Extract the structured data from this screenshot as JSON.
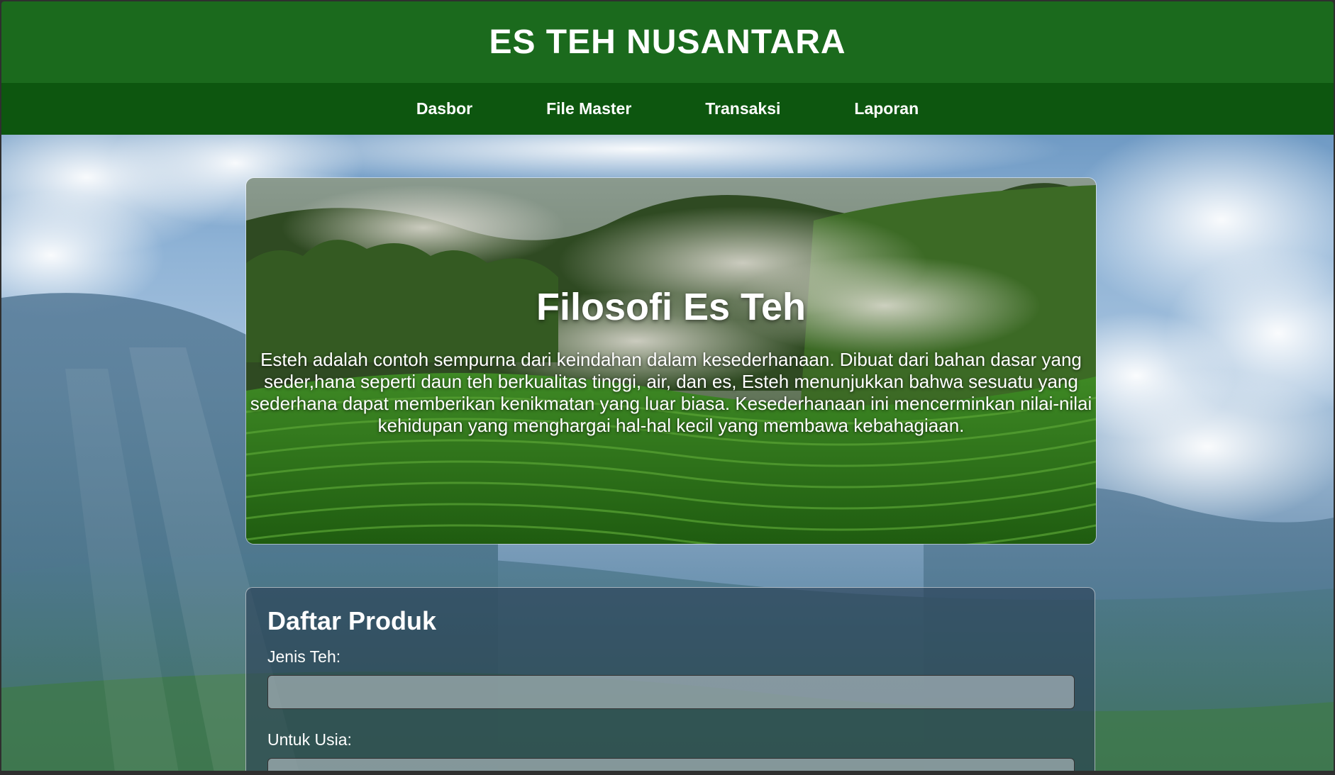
{
  "app": {
    "title": "ES TEH NUSANTARA"
  },
  "nav": {
    "items": [
      {
        "label": "Dasbor"
      },
      {
        "label": "File Master"
      },
      {
        "label": "Transaksi"
      },
      {
        "label": "Laporan"
      }
    ]
  },
  "hero": {
    "title": "Filosofi Es Teh",
    "text": "Esteh adalah contoh sempurna dari keindahan dalam kesederhanaan. Dibuat dari bahan dasar yang seder,hana seperti daun teh berkualitas tinggi, air, dan es, Esteh menunjukkan bahwa sesuatu yang sederhana dapat memberikan kenikmatan yang luar biasa. Kesederhanaan ini mencerminkan nilai-nilai kehidupan yang menghargai hal-hal kecil yang membawa kebahagiaan."
  },
  "product_form": {
    "title": "Daftar Produk",
    "fields": [
      {
        "label": "Jenis Teh:",
        "value": "",
        "placeholder": ""
      },
      {
        "label": "Untuk Usia:",
        "value": "",
        "placeholder": ""
      }
    ]
  },
  "colors": {
    "header": "#1b6a1d",
    "nav": "#0d560f",
    "text": "#ffffff"
  }
}
